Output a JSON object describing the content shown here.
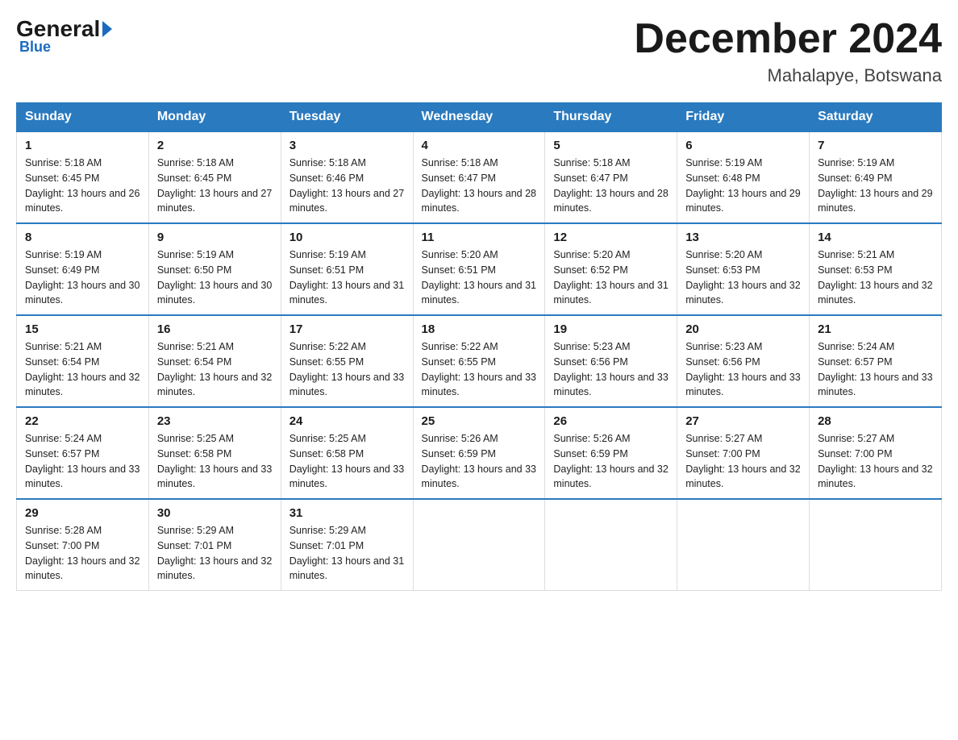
{
  "logo": {
    "general": "General",
    "blue": "Blue",
    "subtitle": "Blue"
  },
  "title": {
    "month_year": "December 2024",
    "location": "Mahalapye, Botswana"
  },
  "days_of_week": [
    "Sunday",
    "Monday",
    "Tuesday",
    "Wednesday",
    "Thursday",
    "Friday",
    "Saturday"
  ],
  "weeks": [
    [
      {
        "day": "1",
        "sunrise": "5:18 AM",
        "sunset": "6:45 PM",
        "daylight": "13 hours and 26 minutes."
      },
      {
        "day": "2",
        "sunrise": "5:18 AM",
        "sunset": "6:45 PM",
        "daylight": "13 hours and 27 minutes."
      },
      {
        "day": "3",
        "sunrise": "5:18 AM",
        "sunset": "6:46 PM",
        "daylight": "13 hours and 27 minutes."
      },
      {
        "day": "4",
        "sunrise": "5:18 AM",
        "sunset": "6:47 PM",
        "daylight": "13 hours and 28 minutes."
      },
      {
        "day": "5",
        "sunrise": "5:18 AM",
        "sunset": "6:47 PM",
        "daylight": "13 hours and 28 minutes."
      },
      {
        "day": "6",
        "sunrise": "5:19 AM",
        "sunset": "6:48 PM",
        "daylight": "13 hours and 29 minutes."
      },
      {
        "day": "7",
        "sunrise": "5:19 AM",
        "sunset": "6:49 PM",
        "daylight": "13 hours and 29 minutes."
      }
    ],
    [
      {
        "day": "8",
        "sunrise": "5:19 AM",
        "sunset": "6:49 PM",
        "daylight": "13 hours and 30 minutes."
      },
      {
        "day": "9",
        "sunrise": "5:19 AM",
        "sunset": "6:50 PM",
        "daylight": "13 hours and 30 minutes."
      },
      {
        "day": "10",
        "sunrise": "5:19 AM",
        "sunset": "6:51 PM",
        "daylight": "13 hours and 31 minutes."
      },
      {
        "day": "11",
        "sunrise": "5:20 AM",
        "sunset": "6:51 PM",
        "daylight": "13 hours and 31 minutes."
      },
      {
        "day": "12",
        "sunrise": "5:20 AM",
        "sunset": "6:52 PM",
        "daylight": "13 hours and 31 minutes."
      },
      {
        "day": "13",
        "sunrise": "5:20 AM",
        "sunset": "6:53 PM",
        "daylight": "13 hours and 32 minutes."
      },
      {
        "day": "14",
        "sunrise": "5:21 AM",
        "sunset": "6:53 PM",
        "daylight": "13 hours and 32 minutes."
      }
    ],
    [
      {
        "day": "15",
        "sunrise": "5:21 AM",
        "sunset": "6:54 PM",
        "daylight": "13 hours and 32 minutes."
      },
      {
        "day": "16",
        "sunrise": "5:21 AM",
        "sunset": "6:54 PM",
        "daylight": "13 hours and 32 minutes."
      },
      {
        "day": "17",
        "sunrise": "5:22 AM",
        "sunset": "6:55 PM",
        "daylight": "13 hours and 33 minutes."
      },
      {
        "day": "18",
        "sunrise": "5:22 AM",
        "sunset": "6:55 PM",
        "daylight": "13 hours and 33 minutes."
      },
      {
        "day": "19",
        "sunrise": "5:23 AM",
        "sunset": "6:56 PM",
        "daylight": "13 hours and 33 minutes."
      },
      {
        "day": "20",
        "sunrise": "5:23 AM",
        "sunset": "6:56 PM",
        "daylight": "13 hours and 33 minutes."
      },
      {
        "day": "21",
        "sunrise": "5:24 AM",
        "sunset": "6:57 PM",
        "daylight": "13 hours and 33 minutes."
      }
    ],
    [
      {
        "day": "22",
        "sunrise": "5:24 AM",
        "sunset": "6:57 PM",
        "daylight": "13 hours and 33 minutes."
      },
      {
        "day": "23",
        "sunrise": "5:25 AM",
        "sunset": "6:58 PM",
        "daylight": "13 hours and 33 minutes."
      },
      {
        "day": "24",
        "sunrise": "5:25 AM",
        "sunset": "6:58 PM",
        "daylight": "13 hours and 33 minutes."
      },
      {
        "day": "25",
        "sunrise": "5:26 AM",
        "sunset": "6:59 PM",
        "daylight": "13 hours and 33 minutes."
      },
      {
        "day": "26",
        "sunrise": "5:26 AM",
        "sunset": "6:59 PM",
        "daylight": "13 hours and 32 minutes."
      },
      {
        "day": "27",
        "sunrise": "5:27 AM",
        "sunset": "7:00 PM",
        "daylight": "13 hours and 32 minutes."
      },
      {
        "day": "28",
        "sunrise": "5:27 AM",
        "sunset": "7:00 PM",
        "daylight": "13 hours and 32 minutes."
      }
    ],
    [
      {
        "day": "29",
        "sunrise": "5:28 AM",
        "sunset": "7:00 PM",
        "daylight": "13 hours and 32 minutes."
      },
      {
        "day": "30",
        "sunrise": "5:29 AM",
        "sunset": "7:01 PM",
        "daylight": "13 hours and 32 minutes."
      },
      {
        "day": "31",
        "sunrise": "5:29 AM",
        "sunset": "7:01 PM",
        "daylight": "13 hours and 31 minutes."
      },
      null,
      null,
      null,
      null
    ]
  ]
}
